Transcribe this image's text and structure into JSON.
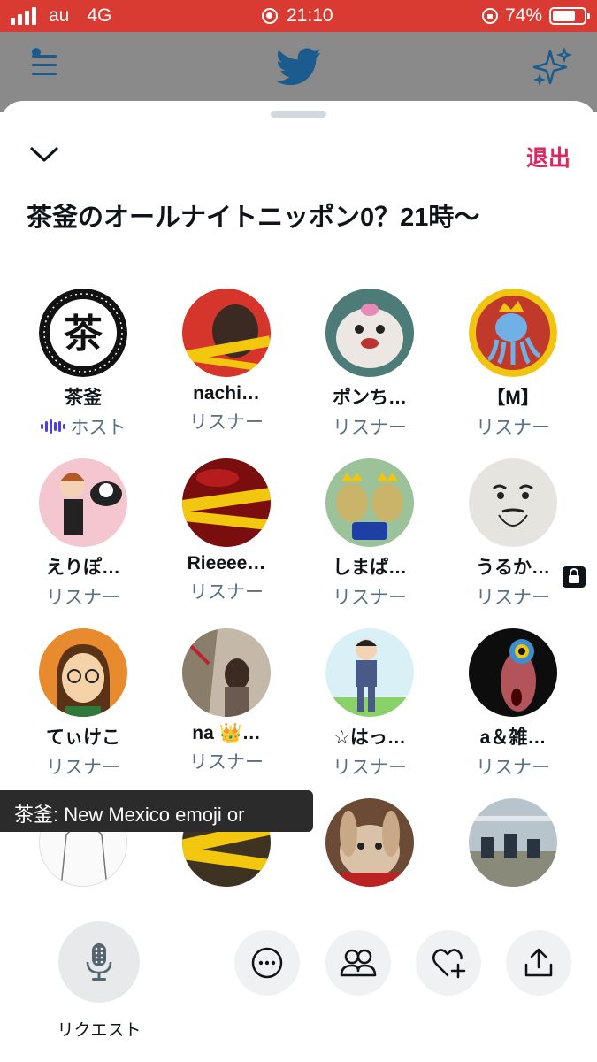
{
  "status_bar": {
    "carrier": "au",
    "network": "4G",
    "time": "21:10",
    "battery": "74%",
    "battery_level": 0.74,
    "color": "#d93b33"
  },
  "header": {
    "menu_icon": "menu-icon",
    "logo_icon": "twitter-bird-icon",
    "sparkle_icon": "sparkle-icon"
  },
  "space": {
    "leave_label": "退出",
    "title": "茶釜のオールナイトニッポン0？21時〜",
    "accent": "#e0245e"
  },
  "participants": [
    {
      "name": "茶釜",
      "role": "ホスト",
      "speaking": true
    },
    {
      "name": "nachi…",
      "role": "リスナー"
    },
    {
      "name": "ポンち…",
      "role": "リスナー"
    },
    {
      "name": "【M】",
      "role": "リスナー"
    },
    {
      "name": "えりぽ…",
      "role": "リスナー"
    },
    {
      "name": "Rieeee…",
      "role": "リスナー"
    },
    {
      "name": "しまぱ…",
      "role": "リスナー"
    },
    {
      "name": "うるか…",
      "role": "リスナー",
      "locked": true
    },
    {
      "name": "てぃけこ",
      "role": "リスナー"
    },
    {
      "name": "na 👑…",
      "role": "リスナー"
    },
    {
      "name": "☆はっ…",
      "role": "リスナー"
    },
    {
      "name": "a＆雑…",
      "role": "リスナー"
    },
    {
      "name": "",
      "role": ""
    },
    {
      "name": "",
      "role": ""
    },
    {
      "name": "",
      "role": ""
    },
    {
      "name": "",
      "role": ""
    }
  ],
  "tooltip": "茶釜: New Mexico emoji or",
  "bottom": {
    "request_label": "リクエスト",
    "buttons": [
      "more-icon",
      "people-icon",
      "heart-add-icon",
      "share-icon"
    ]
  },
  "avatar_glyph": "茶"
}
